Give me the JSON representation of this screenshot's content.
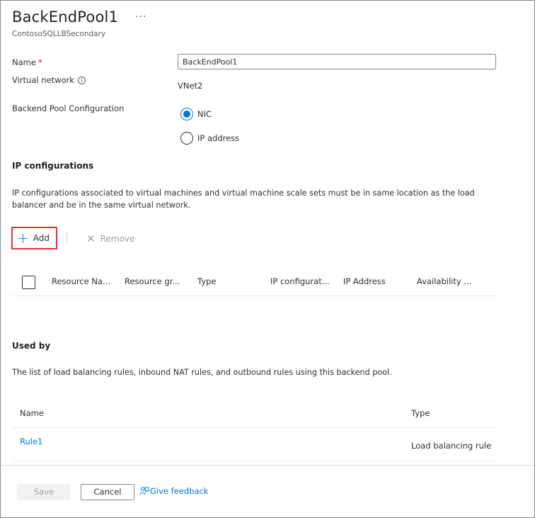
{
  "header": {
    "title": "BackEndPool1",
    "more": "···",
    "subtitle": "ContosoSQLLBSecondary"
  },
  "form": {
    "name_label": "Name",
    "required_mark": "*",
    "name_value": "BackEndPool1",
    "vnet_label": "Virtual network",
    "vnet_value": "VNet2",
    "pool_config_label": "Backend Pool Configuration",
    "options": [
      {
        "label": "NIC",
        "selected": true
      },
      {
        "label": "IP address",
        "selected": false
      }
    ]
  },
  "ip_config": {
    "title": "IP configurations",
    "description": "IP configurations associated to virtual machines and virtual machine scale sets must be in same location as the load balancer and be in the same virtual network.",
    "add_label": "Add",
    "remove_label": "Remove",
    "columns": [
      "Resource Na...",
      "Resource gr...",
      "Type",
      "IP configurat...",
      "IP Address",
      "Availability ..."
    ]
  },
  "used_by": {
    "title": "Used by",
    "description": "The list of load balancing rules, inbound NAT rules, and outbound rules using this backend pool.",
    "columns": [
      "Name",
      "Type"
    ],
    "rows": [
      {
        "name": "Rule1",
        "type": "Load balancing rule"
      }
    ]
  },
  "footer": {
    "save_label": "Save",
    "cancel_label": "Cancel",
    "feedback_label": "Give feedback"
  },
  "colors": {
    "accent": "#0078d4",
    "highlight": "#e8333a",
    "required": "#a4262c"
  }
}
